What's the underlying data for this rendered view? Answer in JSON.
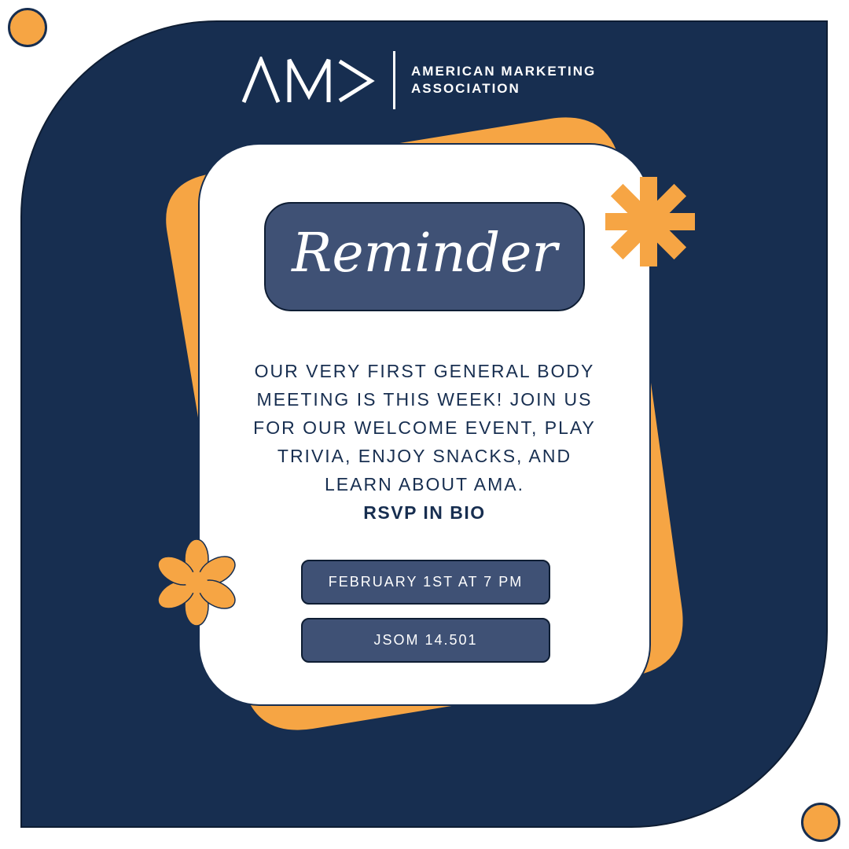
{
  "brand": {
    "logo_mark": "AM>",
    "org_line1": "AMERICAN MARKETING",
    "org_line2": "ASSOCIATION"
  },
  "headline": "Reminder",
  "message_lines": [
    "OUR VERY FIRST GENERAL BODY",
    "MEETING IS THIS WEEK! JOIN US",
    "FOR OUR WELCOME EVENT, PLAY",
    "TRIVIA, ENJOY SNACKS, AND",
    "LEARN ABOUT AMA."
  ],
  "call_to_action": "RSVP IN BIO",
  "event": {
    "datetime": "FEBRUARY 1ST AT 7 PM",
    "location": "JSOM 14.501"
  },
  "colors": {
    "navy": "#172e50",
    "slate": "#3f5175",
    "orange": "#f6a544",
    "white": "#ffffff"
  },
  "decorations": [
    "asterisk-icon",
    "flower-icon",
    "circle-dot-icon"
  ]
}
